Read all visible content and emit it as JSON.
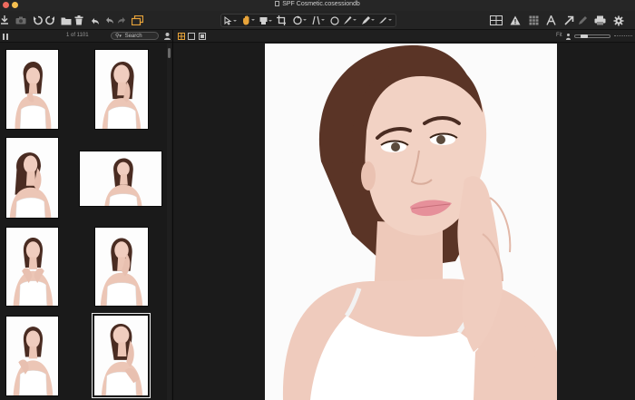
{
  "window": {
    "title": "SPF Cosmetic.cosessiondb"
  },
  "colors": {
    "accent": "#e8a43a",
    "background": "#1a1a1a",
    "toolbar": "#242424"
  },
  "toolbar": {
    "left_icons": [
      "import-icon",
      "camera-icon",
      "rotate-left-icon",
      "rotate-right-icon",
      "folder-icon",
      "trash-icon",
      "undo-all-icon",
      "undo-icon",
      "redo-icon",
      "copy-adjustments-icon"
    ],
    "cursor_tools": [
      "select-icon",
      "pan-icon",
      "loupe-icon",
      "crop-icon",
      "rotate-icon",
      "keystone-icon",
      "spot-icon",
      "brush-icon",
      "eraser-icon"
    ],
    "right_icons": [
      "viewer-grid-icon",
      "warning-icon",
      "grid-icon",
      "text-icon",
      "cursor-arrow-icon",
      "pen-icon",
      "print-icon",
      "settings-icon"
    ]
  },
  "browser": {
    "count_label": "1 of 1101",
    "search_placeholder": "Search"
  },
  "viewer": {
    "fit_label": "Fit"
  }
}
